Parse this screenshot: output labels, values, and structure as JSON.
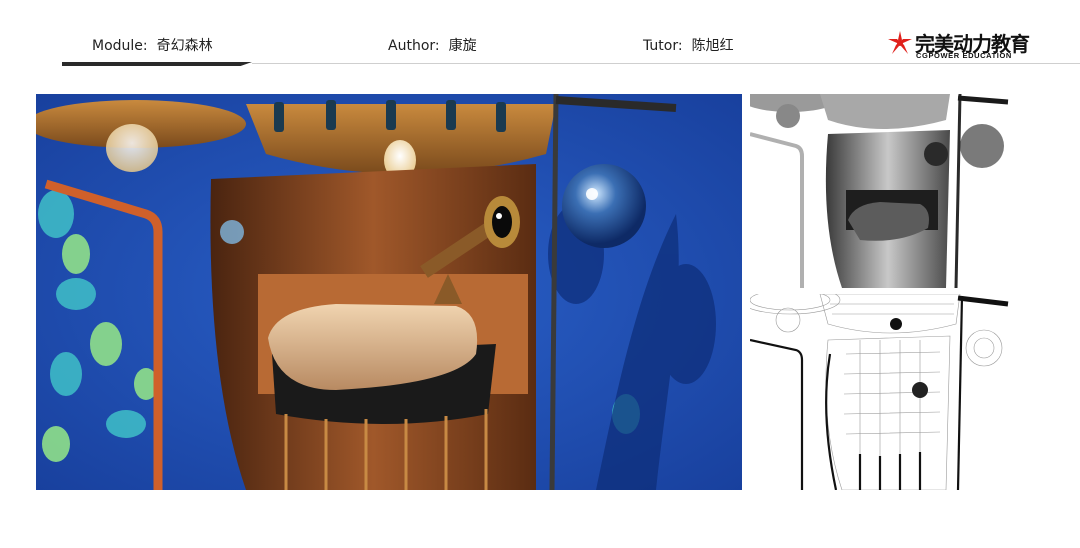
{
  "header": {
    "module_label": "Module:",
    "module_value": "奇幻森林",
    "author_label": "Author:",
    "author_value": "康旋",
    "tutor_label": "Tutor:",
    "tutor_value": "陈旭红"
  },
  "logo": {
    "cn": "完美动力教育",
    "en": "CGPOWER EDUCATION",
    "icon": "red-star-logo-icon"
  },
  "colors": {
    "accent_red": "#e0201b",
    "underline_dark": "#2a2a2a",
    "render_bg_blue": "#1f4fb0"
  },
  "images": {
    "main": "fantasy-forest-chair-color-render",
    "grey": "clay-grey-render",
    "wire": "wireframe-render"
  }
}
